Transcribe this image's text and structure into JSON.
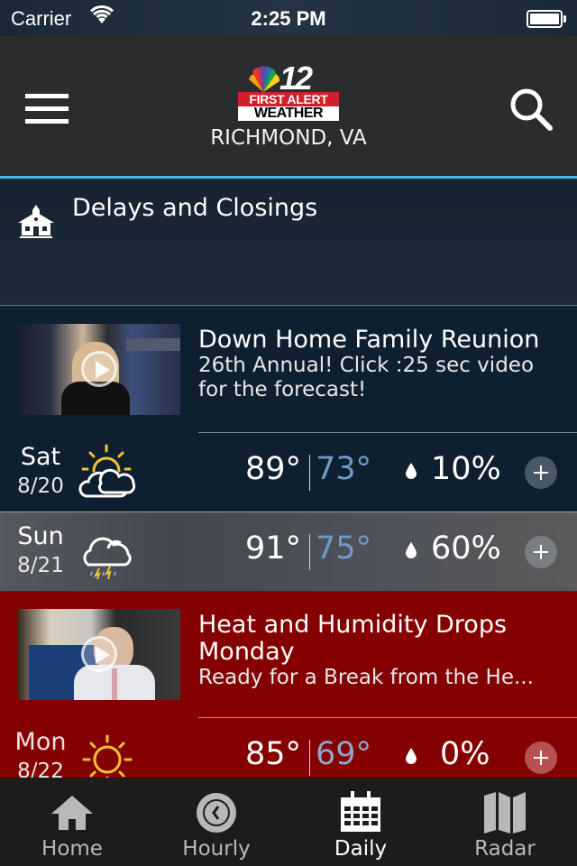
{
  "status_bar": {
    "carrier": "Carrier",
    "time": "2:25 PM"
  },
  "header": {
    "logo": {
      "number": "12",
      "line1": "FIRST ALERT",
      "line2": "WEATHER"
    },
    "location": "RICHMOND, VA",
    "menu_icon": "hamburger-menu-icon",
    "search_icon": "search-icon"
  },
  "closings": {
    "icon": "school-house-icon",
    "label": "Delays and Closings"
  },
  "videos": [
    {
      "title": "Down Home Family Reunion",
      "subtitle": "26th Annual! Click :25 sec video\nfor the forecast!"
    },
    {
      "title": "Heat and Humidity Drops Monday",
      "subtitle": "Ready for a Break from the He..."
    }
  ],
  "days": [
    {
      "day": "Sat",
      "date": "8/20",
      "icon": "partly-cloudy-icon",
      "high": "89°",
      "low": "73°",
      "precip": "10%"
    },
    {
      "day": "Sun",
      "date": "8/21",
      "icon": "thunderstorm-icon",
      "high": "91°",
      "low": "75°",
      "precip": "60%"
    },
    {
      "day": "Mon",
      "date": "8/22",
      "icon": "sunny-icon",
      "high": "85°",
      "low": "69°",
      "precip": "0%"
    }
  ],
  "tabs": [
    {
      "label": "Home",
      "icon": "home-icon",
      "active": false
    },
    {
      "label": "Hourly",
      "icon": "clock-icon",
      "active": false
    },
    {
      "label": "Daily",
      "icon": "calendar-icon",
      "active": true
    },
    {
      "label": "Radar",
      "icon": "map-icon",
      "active": false
    }
  ],
  "colors": {
    "accent_line": "#4ab6e0",
    "low_temp": "#6f9ac6",
    "alert_red": "#850000",
    "navy_card": "#0e1f2f",
    "sun_yellow": "#f4c430"
  }
}
